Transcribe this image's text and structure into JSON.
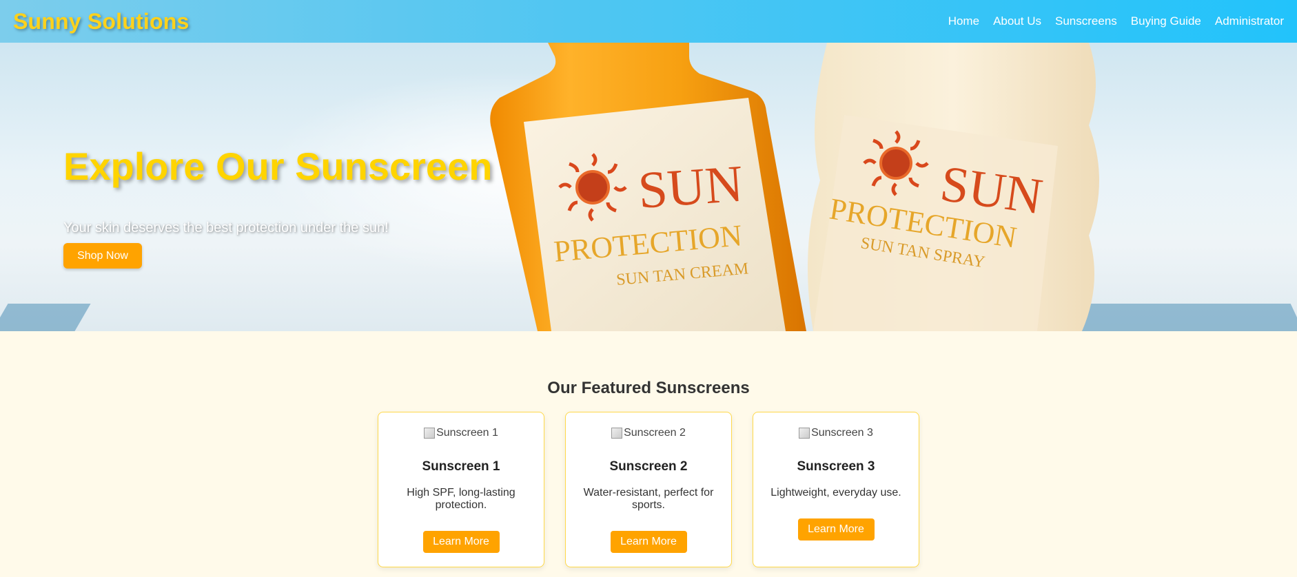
{
  "header": {
    "brand": "Sunny Solutions",
    "nav": [
      "Home",
      "About Us",
      "Sunscreens",
      "Buying Guide",
      "Administrator"
    ]
  },
  "hero": {
    "title": "Explore Our Sunscreen",
    "subtitle": "Your skin deserves the best protection under the sun!",
    "cta_label": "Shop Now",
    "bottles": [
      {
        "brand": "SUN",
        "line": "PROTECTION",
        "product": "SUN TAN CREAM"
      },
      {
        "brand": "SUN",
        "line": "PROTECTION",
        "product": "SUN TAN SPRAY"
      }
    ]
  },
  "featured": {
    "title": "Our Featured Sunscreens",
    "cards": [
      {
        "img_alt": "Sunscreen 1",
        "name": "Sunscreen 1",
        "description": "High SPF, long-lasting protection.",
        "button": "Learn More"
      },
      {
        "img_alt": "Sunscreen 2",
        "name": "Sunscreen 2",
        "description": "Water-resistant, perfect for sports.",
        "button": "Learn More"
      },
      {
        "img_alt": "Sunscreen 3",
        "name": "Sunscreen 3",
        "description": "Lightweight, everyday use.",
        "button": "Learn More"
      }
    ]
  },
  "colors": {
    "header_gradient_start": "#7ccdec",
    "header_gradient_end": "#22c3fb",
    "brand_yellow": "#ffd21c",
    "accent_orange": "#ffa300",
    "page_background": "#fffaea",
    "card_border": "#ffd94a"
  }
}
